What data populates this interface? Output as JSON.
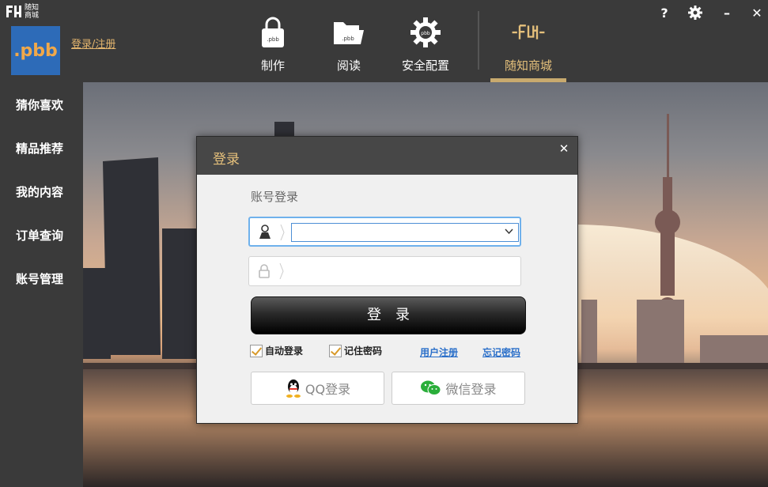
{
  "brand": {
    "logo_text": "随知商城",
    "app_badge": ".pbb",
    "login_register": "登录/注册"
  },
  "nav": [
    {
      "label": "制作",
      "icon": "lock-pbb-icon"
    },
    {
      "label": "阅读",
      "icon": "folder-pbb-icon"
    },
    {
      "label": "安全配置",
      "icon": "gear-pbb-icon"
    },
    {
      "label": "随知商城",
      "icon": "brand-mall-icon",
      "active": true
    }
  ],
  "window_controls": {
    "help": "?",
    "settings": "gear-icon",
    "minimize": "–",
    "close": "✕"
  },
  "sidebar": {
    "items": [
      {
        "label": "猜你喜欢"
      },
      {
        "label": "精品推荐"
      },
      {
        "label": "我的内容"
      },
      {
        "label": "订单查询"
      },
      {
        "label": "账号管理"
      }
    ]
  },
  "modal": {
    "title": "登录",
    "section_label": "账号登录",
    "username": {
      "value": "",
      "placeholder": ""
    },
    "password": {
      "value": "",
      "placeholder": ""
    },
    "login_button": "登录",
    "auto_login": {
      "label": "自动登录",
      "checked": true
    },
    "remember_password": {
      "label": "记住密码",
      "checked": true
    },
    "register_link": "用户注册",
    "forgot_link": "忘记密码",
    "qq_login": "QQ登录",
    "wechat_login": "微信登录"
  },
  "colors": {
    "accent_gold": "#e5c07b",
    "badge_blue": "#2d6bb8",
    "link_blue": "#2a6fc9",
    "chrome_dark": "#3a3a3a"
  }
}
